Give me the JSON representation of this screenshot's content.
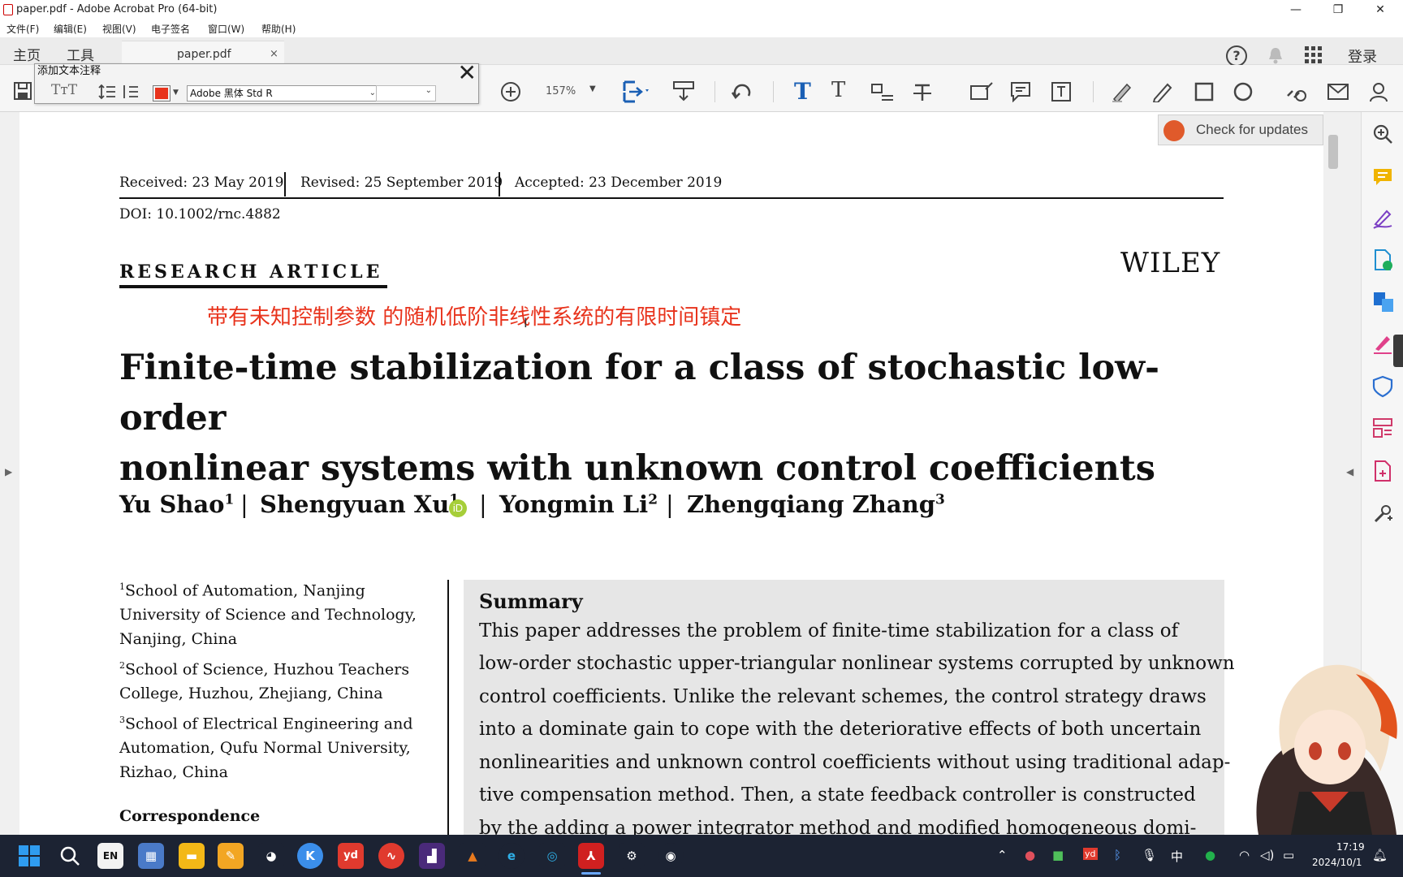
{
  "window": {
    "title": "paper.pdf - Adobe Acrobat Pro (64-bit)",
    "minimize": "—",
    "restore": "❐",
    "close": "✕"
  },
  "menu": [
    "文件(F)",
    "编辑(E)",
    "视图(V)",
    "电子签名",
    "窗口(W)",
    "帮助(H)"
  ],
  "tabs": {
    "home": "主页",
    "tools": "工具",
    "document": "paper.pdf",
    "document_close": "×",
    "login": "登录"
  },
  "annotation_toolbar": {
    "title": "添加文本注释",
    "close": "✕",
    "font_name": "Adobe 黑体 Std R",
    "font_size": "",
    "text_color": "#e8331c"
  },
  "toolbar": {
    "zoom": "157%",
    "check_updates": "Check for updates"
  },
  "document": {
    "received": "Received: 23 May 2019",
    "revised": "Revised: 25 September 2019",
    "accepted": "Accepted: 23 December 2019",
    "doi": "DOI: 10.1002/rnc.4882",
    "article_type": "RESEARCH ARTICLE",
    "publisher": "WILEY",
    "annotation": "带有未知控制参数 的随机低阶非线性系统的有限时间镇定",
    "title_line1": "Finite-time stabilization for a class of stochastic low-order",
    "title_line2": "nonlinear systems with unknown control coefficients",
    "authors": [
      {
        "name": "Yu Shao",
        "sup": "1"
      },
      {
        "name": "Shengyuan Xu",
        "sup": "1"
      },
      {
        "name": "Yongmin Li",
        "sup": "2"
      },
      {
        "name": "Zhengqiang Zhang",
        "sup": "3"
      }
    ],
    "author_sep": "|",
    "affiliations": [
      {
        "sup": "1",
        "lines": [
          "School of Automation, Nanjing",
          "University of Science and Technology,",
          "Nanjing, China"
        ]
      },
      {
        "sup": "2",
        "lines": [
          "School of Science, Huzhou Teachers",
          "College, Huzhou, Zhejiang, China"
        ]
      },
      {
        "sup": "3",
        "lines": [
          "School of Electrical Engineering and",
          "Automation, Qufu Normal University,",
          "Rizhao, China"
        ]
      }
    ],
    "correspondence": "Correspondence",
    "summary_heading": "Summary",
    "summary_lines": [
      "This paper addresses the problem of finite-time stabilization for a class of",
      "low-order stochastic upper-triangular nonlinear systems corrupted by unknown",
      "control coefficients. Unlike the relevant schemes, the control strategy draws",
      "into a dominate gain to cope with the deteriorative effects of both uncertain",
      "nonlinearities and unknown control coefficients without using traditional adap-",
      "tive compensation method. Then, a state feedback controller is constructed",
      "by the adding a power integrator method and modified homogeneous domi-"
    ]
  },
  "taskbar": {
    "ime": "中",
    "time": "17:19",
    "date": "2024/10/1",
    "en": "EN",
    "yd": "yd"
  }
}
